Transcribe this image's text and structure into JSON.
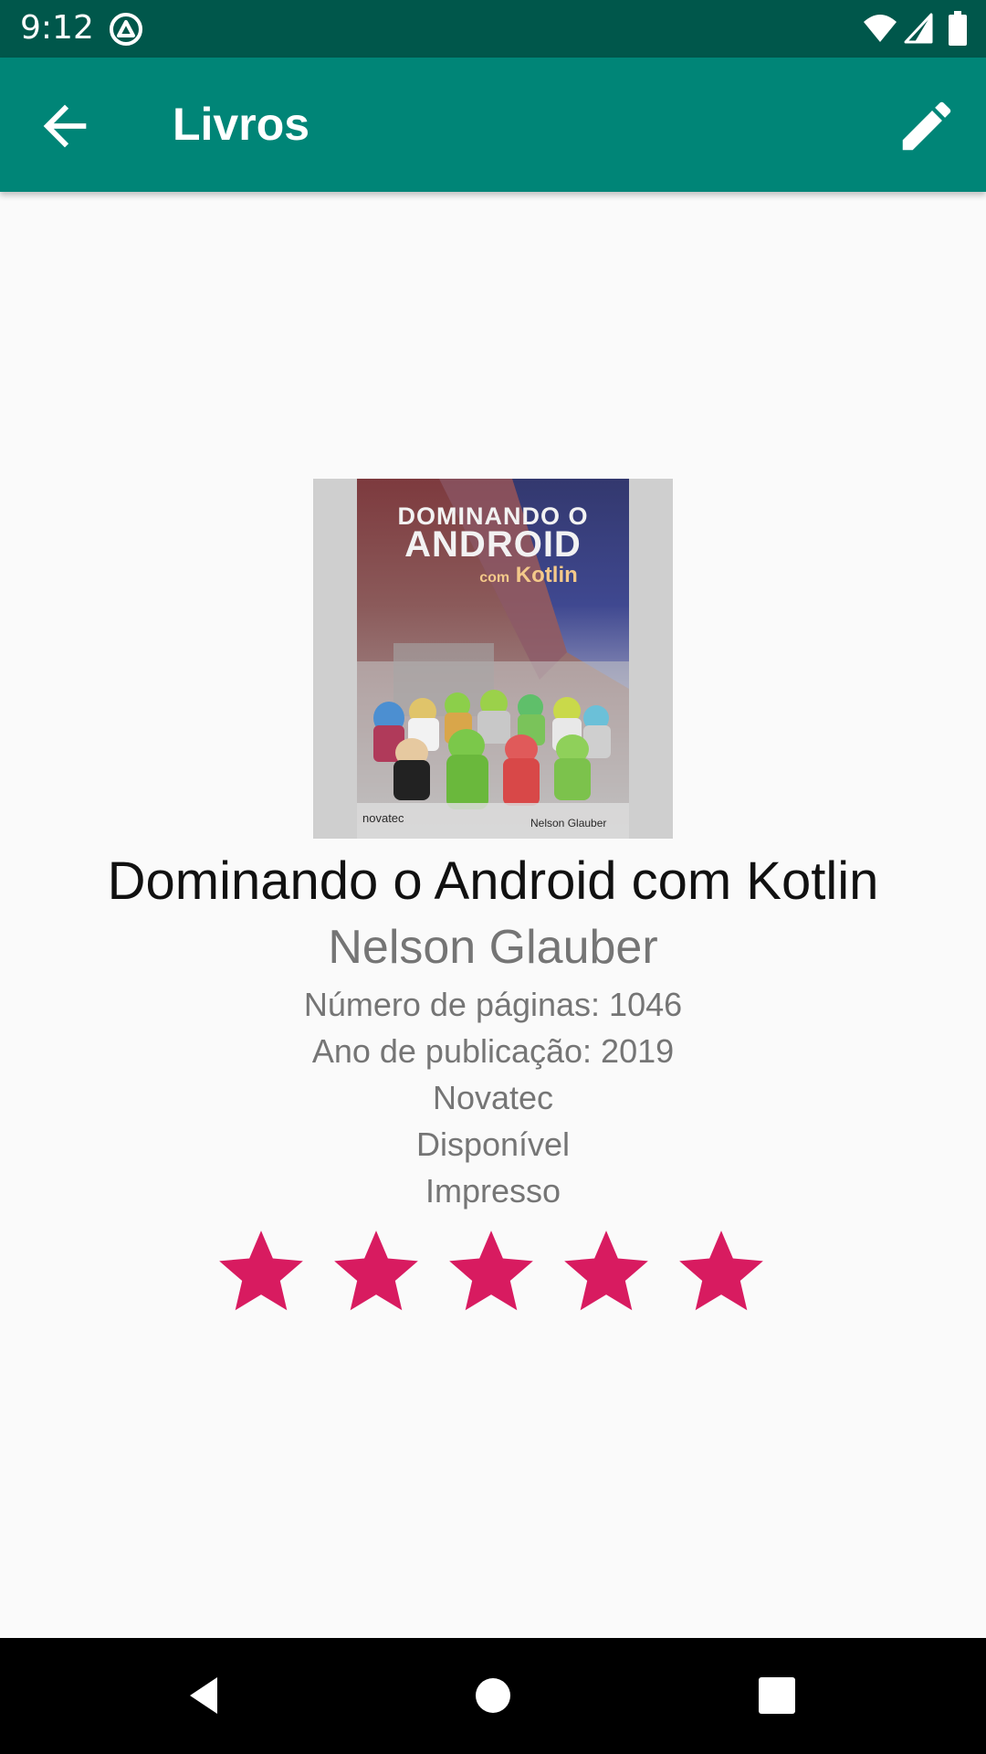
{
  "status_bar": {
    "time": "9:12"
  },
  "app_bar": {
    "title": "Livros",
    "back_icon": "arrow-left-icon",
    "edit_icon": "pencil-icon"
  },
  "book": {
    "cover": {
      "title_line_1": "DOMINANDO O",
      "title_line_2": "ANDROID",
      "subtitle_prefix": "com",
      "subtitle_main": "Kotlin",
      "publisher_mark": "novatec",
      "author_mark": "Nelson Glauber"
    },
    "title": "Dominando o Android com Kotlin",
    "author": "Nelson Glauber",
    "pages": "Número de páginas: 1046",
    "year": "Ano de publicação: 2019",
    "publisher": "Novatec",
    "availability": "Disponível",
    "format": "Impresso",
    "rating": 5,
    "rating_max": 5
  },
  "colors": {
    "status_bar": "#00574b",
    "primary": "#008577",
    "accent": "#d81b60",
    "background": "#fafafa"
  }
}
